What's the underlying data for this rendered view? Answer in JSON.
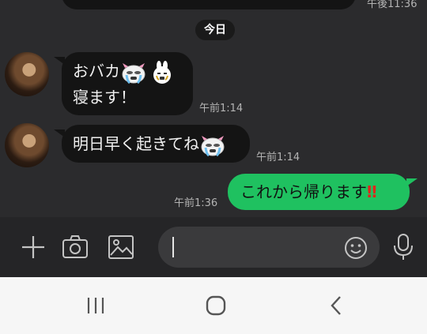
{
  "chat": {
    "top_partial_time": "午後11:36",
    "date_chip": "今日",
    "messages": [
      {
        "side": "in",
        "line1": "おバカ",
        "line2": "寝ます！",
        "time": "午前1:14"
      },
      {
        "side": "in",
        "text": "明日早く起きてね",
        "time": "午前1:14"
      },
      {
        "side": "out",
        "text": "これから帰ります",
        "emoji": "‼",
        "time": "午前1:36"
      }
    ]
  },
  "composer": {
    "input_value": "",
    "icons": [
      "plus-icon",
      "camera-icon",
      "image-icon",
      "emoji-icon",
      "microphone-icon"
    ]
  },
  "navbar": {
    "icons": [
      "recent-apps-icon",
      "home-icon",
      "back-icon"
    ]
  },
  "colors": {
    "chat_bg": "#2b2b2d",
    "incoming_bubble": "#141414",
    "outgoing_bubble": "#1fc160",
    "composer_bg": "#252527",
    "navbar_bg": "#f6f6f6"
  }
}
